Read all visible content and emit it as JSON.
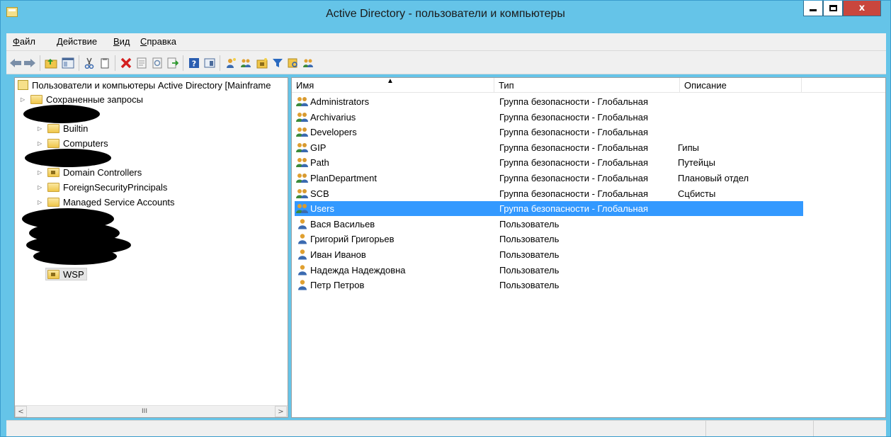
{
  "window": {
    "title": "Active Directory - пользователи и компьютеры",
    "close_glyph": "x"
  },
  "menu": {
    "items": [
      {
        "label_u": "Ф",
        "label_rest": "айл"
      },
      {
        "label_u": "Д",
        "label_rest": "ействие"
      },
      {
        "label_u": "В",
        "label_rest": "ид"
      },
      {
        "label_u": "С",
        "label_rest": "правка"
      }
    ]
  },
  "toolbar": {
    "icons": [
      "back-icon",
      "forward-icon",
      "up-folder-icon",
      "show-hide-tree-icon",
      "cut-icon",
      "copy-icon",
      "delete-icon",
      "properties-icon",
      "refresh-icon",
      "export-list-icon",
      "help-icon",
      "show-console-icon",
      "new-user-icon",
      "new-group-icon",
      "new-ou-icon",
      "filter-icon",
      "find-icon",
      "add-to-group-icon"
    ],
    "colors": {
      "delete": "#d42020",
      "help": "#2a5db0",
      "users": "#e0a030",
      "filter": "#2a6ac0"
    }
  },
  "tree": {
    "root_label": "Пользователи и компьютеры Active Directory [Mainframe",
    "saved_queries": "Сохраненные запросы",
    "builtin": "Builtin",
    "computers": "Computers",
    "domain_controllers": "Domain Controllers",
    "foreign_security_principals": "ForeignSecurityPrincipals",
    "managed_service_accounts": "Managed Service Accounts",
    "wsp": "WSP",
    "scroll_thumb": "III"
  },
  "list": {
    "columns": {
      "name": "Имя",
      "type": "Тип",
      "description": "Описание"
    },
    "rows": [
      {
        "name": "Administrators",
        "type": "Группа безопасности - Глобальная",
        "description": "",
        "kind": "group"
      },
      {
        "name": "Archivarius",
        "type": "Группа безопасности - Глобальная",
        "description": "",
        "kind": "group"
      },
      {
        "name": "Developers",
        "type": "Группа безопасности - Глобальная",
        "description": "",
        "kind": "group"
      },
      {
        "name": "GIP",
        "type": "Группа безопасности - Глобальная",
        "description": "Гипы",
        "kind": "group"
      },
      {
        "name": "Path",
        "type": "Группа безопасности - Глобальная",
        "description": "Путейцы",
        "kind": "group"
      },
      {
        "name": "PlanDepartment",
        "type": "Группа безопасности - Глобальная",
        "description": "Плановый отдел",
        "kind": "group"
      },
      {
        "name": "SCB",
        "type": "Группа безопасности - Глобальная",
        "description": "Сцбисты",
        "kind": "group"
      },
      {
        "name": "Users",
        "type": "Группа безопасности - Глобальная",
        "description": "",
        "kind": "group",
        "selected": true
      },
      {
        "name": "Вася Васильев",
        "type": "Пользователь",
        "description": "",
        "kind": "user"
      },
      {
        "name": "Григорий Григорьев",
        "type": "Пользователь",
        "description": "",
        "kind": "user"
      },
      {
        "name": "Иван Иванов",
        "type": "Пользователь",
        "description": "",
        "kind": "user"
      },
      {
        "name": "Надежда Надеждовна",
        "type": "Пользователь",
        "description": "",
        "kind": "user"
      },
      {
        "name": "Петр Петров",
        "type": "Пользователь",
        "description": "",
        "kind": "user"
      }
    ]
  },
  "colors": {
    "titlebar": "#65c4e8",
    "selection": "#3399ff",
    "close_button": "#c9463d"
  }
}
